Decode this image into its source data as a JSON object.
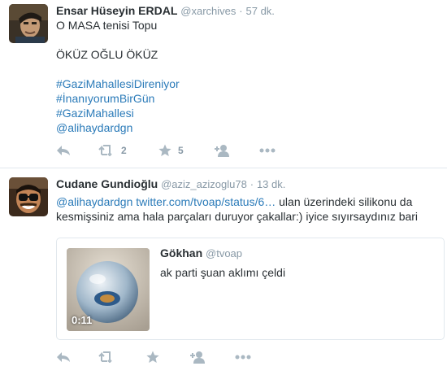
{
  "tweets": [
    {
      "fullname": "Ensar Hüseyin ERDAL",
      "handle": "@xarchives",
      "separator": "·",
      "time": "57 dk.",
      "text_line1": "O MASA tenisi Topu",
      "text_line2": "ÖKÜZ OĞLU ÖKÜZ",
      "hashtags": [
        "#GaziMahallesiDireniyor",
        "#İnanıyorumBirGün",
        "#GaziMahallesi"
      ],
      "mention": "@alihaydardgn",
      "retweet_count": "2",
      "favorite_count": "5"
    },
    {
      "fullname": "Cudane Gundioğlu",
      "handle": "@aziz_azizoglu78",
      "separator": "·",
      "time": "13 dk.",
      "mention": "@alihaydardgn",
      "url": "twitter.com/tvoap/status/6…",
      "text_rest_line1": " ulan üzerindeki silikonu da",
      "text_line2": "kesmişsiniz ama hala parçaları duruyor çakallar:) iyice sıyırsaydınız bari",
      "card": {
        "name": "Gökhan",
        "handle": "@tvoap",
        "text": "ak parti şuan aklımı çeldi",
        "duration": "0:11"
      }
    }
  ],
  "icons": {
    "reply": "reply-icon",
    "retweet": "retweet-icon",
    "favorite": "star-icon",
    "follow": "follow-icon",
    "more": "more-icon"
  },
  "colors": {
    "link": "#2b7bb9",
    "secondary": "#8899a6",
    "icon": "#aab8c2",
    "text": "#292f33"
  }
}
